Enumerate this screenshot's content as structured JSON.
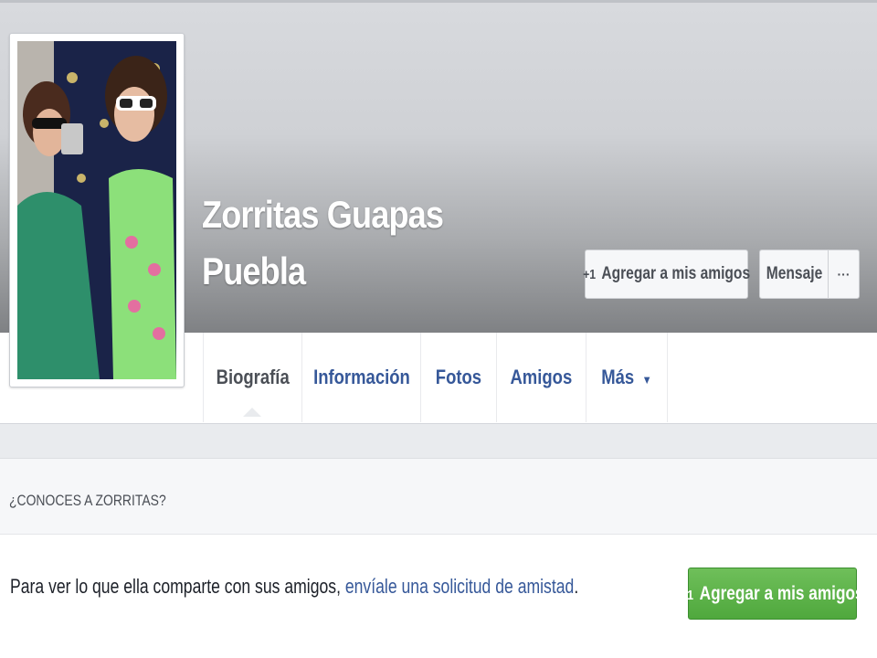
{
  "profile": {
    "name_line1": "Zorritas Guapas",
    "name_line2": "Puebla",
    "picture_icon": "profile-photo"
  },
  "actions": {
    "add_friend_icon": "+1",
    "add_friend_label": "Agregar a mis amigos",
    "message_label": "Mensaje",
    "more_label": "···"
  },
  "tabs": [
    {
      "label": "Biografía",
      "active": true
    },
    {
      "label": "Información"
    },
    {
      "label": "Fotos"
    },
    {
      "label": "Amigos"
    },
    {
      "label": "Más",
      "caret": "▼"
    }
  ],
  "know": {
    "title": "¿CONOCES A ZORRITAS?",
    "text": "Para ver lo que ella comparte con sus amigos, ",
    "link": "envíale una solicitud de amistad",
    "text_end": ".",
    "button_icon": "+1",
    "button_label": "Agregar a mis amigos"
  },
  "colors": {
    "link": "#365899",
    "green_button": "#4fa83d",
    "page_bg": "#e9ebee"
  }
}
